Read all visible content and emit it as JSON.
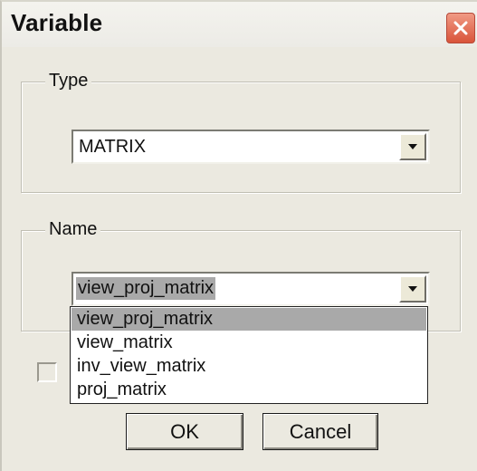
{
  "window": {
    "title": "Variable",
    "close_icon": "close-icon"
  },
  "type_group": {
    "label": "Type",
    "selected_value": "MATRIX",
    "dropdown_icon": "chevron-down-icon"
  },
  "name_group": {
    "label": "Name",
    "selected_value": "view_proj_matrix",
    "dropdown_icon": "chevron-down-icon",
    "options": [
      {
        "label": "view_proj_matrix",
        "selected": true
      },
      {
        "label": "view_matrix",
        "selected": false
      },
      {
        "label": "inv_view_matrix",
        "selected": false
      },
      {
        "label": "proj_matrix",
        "selected": false
      }
    ]
  },
  "checkbox": {
    "checked": false
  },
  "buttons": {
    "ok_label": "OK",
    "cancel_label": "Cancel"
  },
  "colors": {
    "dialog_bg": "#ebe9e0",
    "selection_bg": "#a9a9a9",
    "close_button": "#d9543a"
  }
}
